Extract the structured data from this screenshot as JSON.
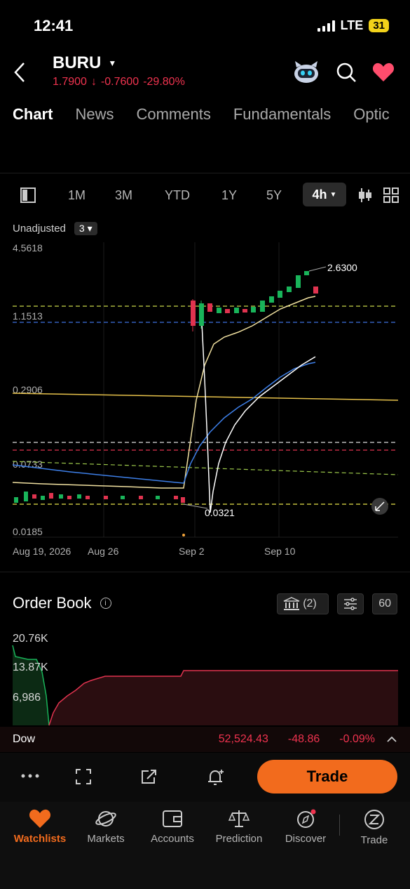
{
  "status": {
    "time": "12:41",
    "network": "LTE",
    "battery": "31"
  },
  "header": {
    "symbol": "BURU",
    "price": "1.7900",
    "change": "-0.7600",
    "change_pct": "-29.80%",
    "down_arrow": "↓"
  },
  "tabs": [
    {
      "label": "Chart",
      "active": true
    },
    {
      "label": "News"
    },
    {
      "label": "Comments"
    },
    {
      "label": "Fundamentals"
    },
    {
      "label": "Optic"
    }
  ],
  "ranges": [
    "1M",
    "3M",
    "YTD",
    "1Y",
    "5Y"
  ],
  "active_range": "4h",
  "chart_options": {
    "adjust": "Unadjusted",
    "count": "3"
  },
  "chart_data": {
    "type": "candlestick",
    "y_scale": "log",
    "y_tick_labels": [
      "4.5618",
      "1.1513",
      "0.2906",
      "0.0733",
      "0.0185"
    ],
    "x_tick_labels": [
      "Aug 19, 2026",
      "Aug 26",
      "Sep 2",
      "Sep 10"
    ],
    "annotations": {
      "high": "2.6300",
      "low": "0.0321"
    },
    "candles_approx": [
      {
        "o": 0.05,
        "c": 0.052
      },
      {
        "o": 0.05,
        "c": 0.058
      },
      {
        "o": 0.052,
        "c": 0.054
      },
      {
        "o": 0.051,
        "c": 0.053
      },
      {
        "o": 0.05,
        "c": 0.053
      },
      {
        "o": 0.052,
        "c": 0.05
      },
      {
        "o": 0.05,
        "c": 0.051
      },
      {
        "o": 0.05,
        "c": 0.052
      },
      {
        "o": 0.051,
        "c": 0.05
      },
      {
        "o": 0.05,
        "c": 0.052
      },
      {
        "o": 0.05,
        "c": 0.049
      },
      {
        "o": 1.25,
        "c": 0.95
      },
      {
        "o": 0.95,
        "c": 1.25
      },
      {
        "o": 1.15,
        "c": 1.3
      },
      {
        "o": 1.1,
        "c": 1.15
      },
      {
        "o": 1.18,
        "c": 1.12
      },
      {
        "o": 1.08,
        "c": 1.14
      },
      {
        "o": 1.1,
        "c": 1.18
      },
      {
        "o": 1.15,
        "c": 1.1
      },
      {
        "o": 1.12,
        "c": 1.2
      },
      {
        "o": 1.12,
        "c": 1.18
      },
      {
        "o": 1.15,
        "c": 1.35
      },
      {
        "o": 1.3,
        "c": 1.45
      },
      {
        "o": 1.45,
        "c": 1.65
      },
      {
        "o": 1.6,
        "c": 1.7
      },
      {
        "o": 1.75,
        "c": 1.95
      },
      {
        "o": 2.0,
        "c": 2.6
      },
      {
        "o": 2.55,
        "c": 2.63
      },
      {
        "o": 2.1,
        "c": 1.79
      }
    ]
  },
  "order_book": {
    "title": "Order Book",
    "y_labels": [
      "20.76K",
      "13.87K",
      "6,986"
    ],
    "exchanges": "(2)",
    "depth": "60"
  },
  "ticker_bar": {
    "name": "Dow",
    "value": "52,524.43",
    "change": "-48.86",
    "change_pct": "-0.09%"
  },
  "action_bar": {
    "trade_label": "Trade"
  },
  "bottom_nav": [
    {
      "label": "Watchlists",
      "icon": "heart-icon",
      "active": true
    },
    {
      "label": "Markets",
      "icon": "planet-icon"
    },
    {
      "label": "Accounts",
      "icon": "wallet-icon"
    },
    {
      "label": "Prediction",
      "icon": "scale-icon"
    },
    {
      "label": "Discover",
      "icon": "compass-icon"
    },
    {
      "label": "Trade",
      "icon": "trade-icon"
    }
  ],
  "colors": {
    "up": "#19b45a",
    "down": "#e0334f",
    "accent": "#f26b1d"
  }
}
